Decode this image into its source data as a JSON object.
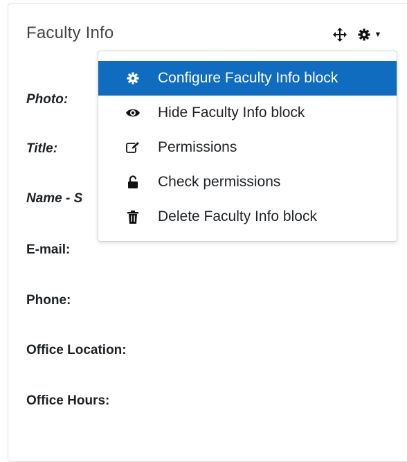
{
  "block": {
    "title": "Faculty Info",
    "fields": [
      {
        "label": "Photo:"
      },
      {
        "label": "Title:"
      },
      {
        "label": "Name - S"
      },
      {
        "label": "E-mail:"
      },
      {
        "label": "Phone:"
      },
      {
        "label": "Office Location:"
      },
      {
        "label": "Office Hours:"
      }
    ]
  },
  "controls": {
    "move_icon": "move-arrows-icon",
    "gear_icon": "gear-icon",
    "caret_icon": "caret-down-icon"
  },
  "menu": {
    "items": [
      {
        "label": "Configure Faculty Info block",
        "icon": "gear-icon",
        "active": true
      },
      {
        "label": "Hide Faculty Info block",
        "icon": "eye-icon",
        "active": false
      },
      {
        "label": "Permissions",
        "icon": "edit-icon",
        "active": false
      },
      {
        "label": "Check permissions",
        "icon": "unlock-icon",
        "active": false
      },
      {
        "label": "Delete Faculty Info block",
        "icon": "trash-icon",
        "active": false
      }
    ]
  },
  "colors": {
    "active_item_bg": "#0f6cbf",
    "active_item_text": "#ffffff",
    "border": "#dee2e6"
  }
}
